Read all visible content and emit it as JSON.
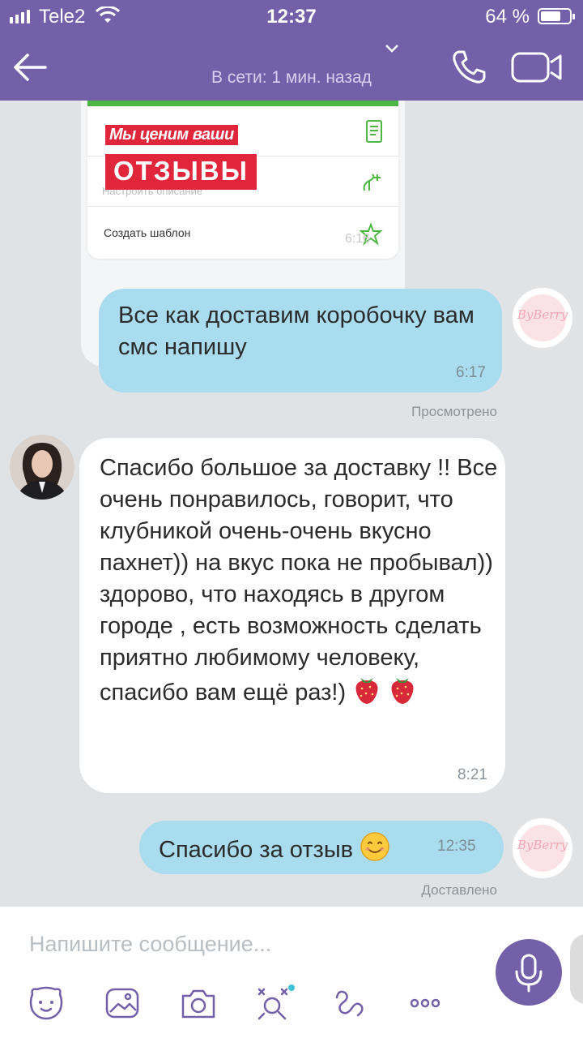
{
  "status_bar": {
    "carrier": "Tele2",
    "time": "12:37",
    "battery": "64 %"
  },
  "header": {
    "contact_name": "",
    "presence": "В сети: 1 мин. назад"
  },
  "shared_card": {
    "banner_line1": "Мы ценим ваши",
    "banner_line2": "ОТЗЫВЫ",
    "faded_text": "Настроить описание",
    "row_label": "Создать шаблон",
    "time": "6:16"
  },
  "messages": [
    {
      "direction": "out",
      "text": "Все как доставим коробочку вам смс напишу",
      "time": "6:17",
      "status": "Просмотрено"
    },
    {
      "direction": "in",
      "text": "Спасибо большое за доставку !! Все очень понравилось, говорит, что клубникой очень-очень вкусно пахнет)) на вкус пока не пробывал)) здорово, что находясь в другом городе , есть возможность сделать приятно любимому человеку, спасибо вам ещё раз!)",
      "time": "8:21"
    },
    {
      "direction": "out",
      "text": "Спасибо за отзыв",
      "time": "12:35",
      "status": "Доставлено"
    }
  ],
  "avatars": {
    "brand_text": "ByBerry"
  },
  "composer": {
    "placeholder": "Напишите сообщение..."
  },
  "toolbar_icons": [
    "sticker-icon",
    "gallery-icon",
    "camera-icon",
    "game-icon",
    "doodle-icon",
    "more-icon"
  ],
  "colors": {
    "header": "#7360a8",
    "outgoing_bubble": "#a9dcef",
    "incoming_bubble": "#ffffff",
    "background": "#dfe3e6"
  }
}
